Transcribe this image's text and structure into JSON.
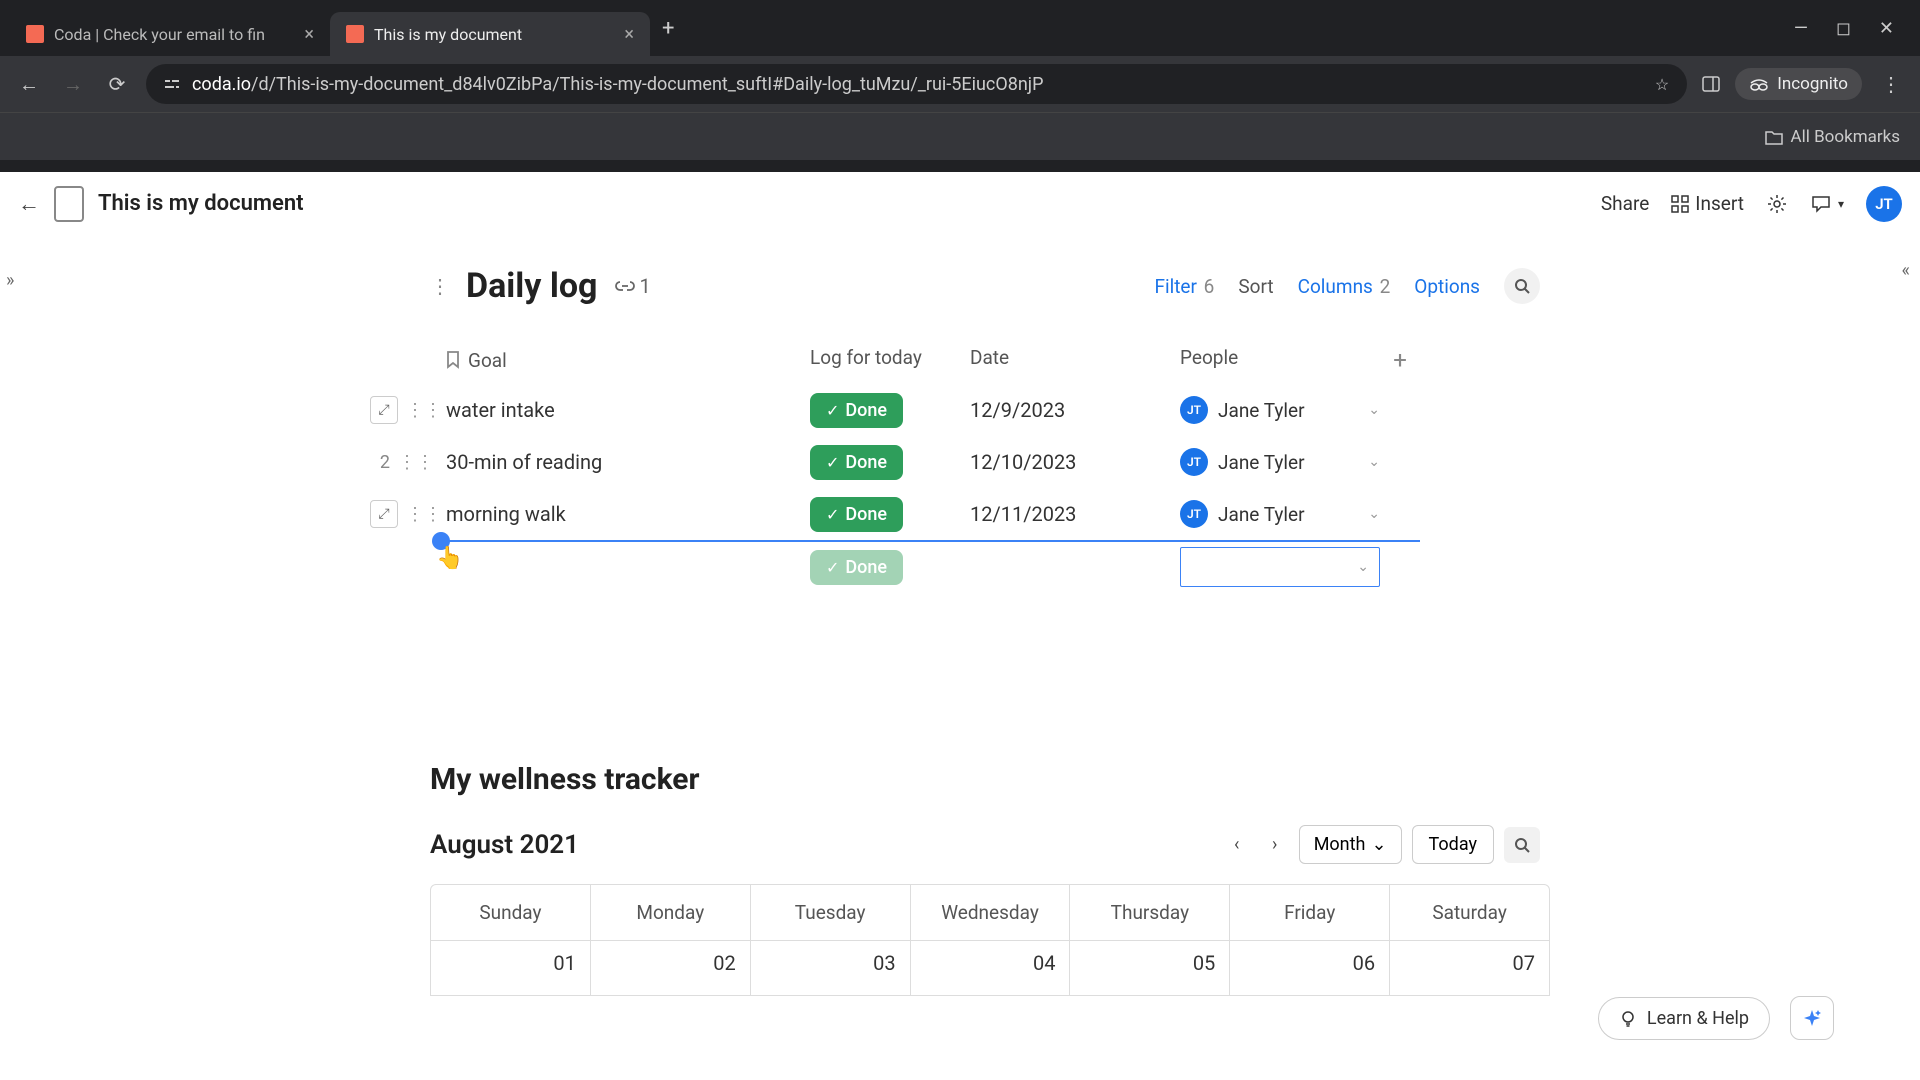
{
  "browser": {
    "tabs": [
      {
        "title": "Coda | Check your email to fin"
      },
      {
        "title": "This is my document"
      }
    ],
    "url_domain": "coda.io",
    "url_path": "/d/This-is-my-document_d84lv0ZibPa/This-is-my-document_suftI#Daily-log_tuMzu/_rui-5EiucO8njP",
    "incognito_label": "Incognito",
    "bookmarks_label": "All Bookmarks"
  },
  "app": {
    "doc_title": "This is my document",
    "share_label": "Share",
    "insert_label": "Insert",
    "avatar_initials": "JT"
  },
  "daily_log": {
    "title": "Daily log",
    "link_count": "1",
    "controls": {
      "filter_label": "Filter",
      "filter_count": "6",
      "sort_label": "Sort",
      "columns_label": "Columns",
      "columns_count": "2",
      "options_label": "Options"
    },
    "columns": {
      "goal": "Goal",
      "log": "Log for today",
      "date": "Date",
      "people": "People"
    },
    "rows": [
      {
        "num": "",
        "goal": "water intake",
        "log": "Done",
        "date": "12/9/2023",
        "person": "Jane Tyler",
        "initials": "JT",
        "show_expand": true
      },
      {
        "num": "2",
        "goal": "30-min of reading",
        "log": "Done",
        "date": "12/10/2023",
        "person": "Jane Tyler",
        "initials": "JT",
        "show_expand": false
      },
      {
        "num": "",
        "goal": "morning walk",
        "log": "Done",
        "date": "12/11/2023",
        "person": "Jane Tyler",
        "initials": "JT",
        "show_expand": true
      }
    ],
    "new_row_log": "Done"
  },
  "wellness": {
    "title": "My wellness tracker",
    "month_label": "August 2021",
    "view_label": "Month",
    "today_label": "Today",
    "days": [
      "Sunday",
      "Monday",
      "Tuesday",
      "Wednesday",
      "Thursday",
      "Friday",
      "Saturday"
    ],
    "dates": [
      "01",
      "02",
      "03",
      "04",
      "05",
      "06",
      "07"
    ]
  },
  "help_label": "Learn & Help"
}
